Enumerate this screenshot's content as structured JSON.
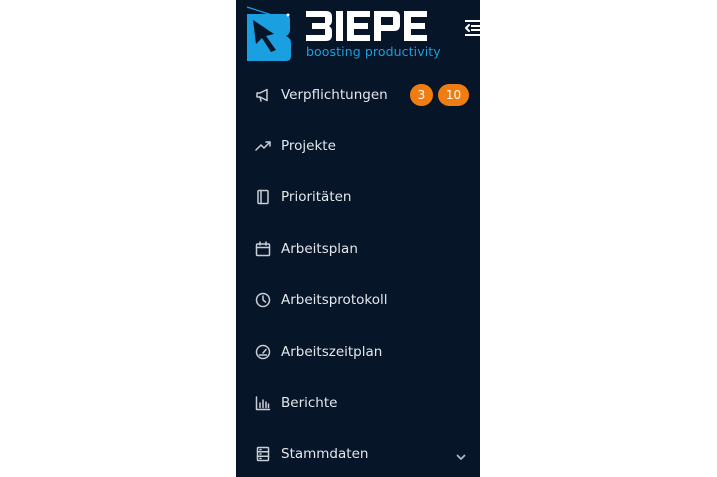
{
  "brand": {
    "wordmark": "BIEPE",
    "tagline": "boosting productivity",
    "primary_color": "#1a9fe0",
    "sidebar_color": "#061528"
  },
  "header": {
    "collapse_icon": "menu-collapse-icon"
  },
  "menu": {
    "items": [
      {
        "label": "Verpflichtungen",
        "icon": "megaphone-icon",
        "badges": [
          "3",
          "10"
        ]
      },
      {
        "label": "Projekte",
        "icon": "trending-up-icon"
      },
      {
        "label": "Prioritäten",
        "icon": "book-icon"
      },
      {
        "label": "Arbeitsplan",
        "icon": "calendar-icon"
      },
      {
        "label": "Arbeitsprotokoll",
        "icon": "clock-icon"
      },
      {
        "label": "Arbeitszeitplan",
        "icon": "dashboard-icon"
      },
      {
        "label": "Berichte",
        "icon": "bar-chart-icon"
      },
      {
        "label": "Stammdaten",
        "icon": "database-icon",
        "expandable": true
      }
    ],
    "badge_color": "#f07d12"
  }
}
